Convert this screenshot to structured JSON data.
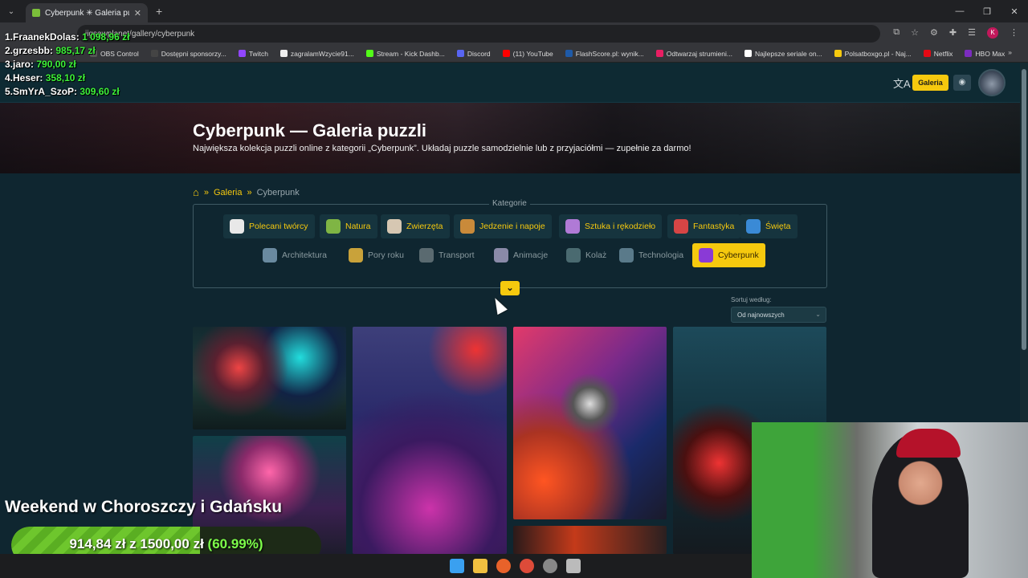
{
  "browser": {
    "tab_title": "Cyberpunk ✳ Galeria puzzli",
    "url": "jigsawplanet/gallery/cyberpunk",
    "bookmarks": [
      "OBS Control",
      "Dostępni sponsorzy...",
      "Twitch",
      "zagralamWzycie91...",
      "Stream - Kick Dashb...",
      "Discord",
      "(11) YouTube",
      "FlashScore.pl: wynik...",
      "Odtwarzaj strumieni...",
      "Najlepsze seriale on...",
      "Polsatboxgo.pl - Naj...",
      "Netflix",
      "HBO Max"
    ],
    "bookmark_colors": [
      "#555",
      "#444",
      "#9146ff",
      "#eee",
      "#53fc18",
      "#5865f2",
      "#ff0000",
      "#1e5aa8",
      "#e91e63",
      "#fff",
      "#f6c90e",
      "#e50914",
      "#7b2cbf"
    ]
  },
  "site": {
    "header_button": "Galeria",
    "hero_title": "Cyberpunk — Galeria puzzli",
    "hero_subtitle": "Największa kolekcja puzzli online z kategorii „Cyberpunk”. Układaj puzzle samodzielnie lub z przyjaciółmi — zupełnie za darmo!",
    "breadcrumb": {
      "root": "Galeria",
      "current": "Cyberpunk",
      "separator": "»"
    },
    "categories_title": "Kategorie",
    "categories_row1": [
      {
        "label": "Polecani twórcy",
        "color": "#e8e8e8"
      },
      {
        "label": "Natura",
        "color": "#7fb544"
      },
      {
        "label": "Zwierzęta",
        "color": "#d6c7b2"
      },
      {
        "label": "Jedzenie i napoje",
        "color": "#c98a3a"
      },
      {
        "label": "Sztuka i rękodzieło",
        "color": "#b07ad6"
      },
      {
        "label": "Fantastyka",
        "color": "#d64545"
      },
      {
        "label": "Święta",
        "color": "#3a8ad6"
      }
    ],
    "categories_row2": [
      {
        "label": "Architektura",
        "color": "#6a8aa0"
      },
      {
        "label": "Pory roku",
        "color": "#c9a23a"
      },
      {
        "label": "Transport",
        "color": "#5a6a70"
      },
      {
        "label": "Animacje",
        "color": "#8a8aa8"
      },
      {
        "label": "Kolaż",
        "color": "#4a6a70"
      },
      {
        "label": "Technologia",
        "color": "#5a7a8a"
      },
      {
        "label": "Cyberpunk",
        "color": "#8a3ad6"
      }
    ],
    "sort_label": "Sortuj według:",
    "sort_value": "Od najnowszych"
  },
  "overlay": {
    "leaderboard": [
      {
        "name": "1.FraanekDolas:",
        "value": "1 098,96 zł"
      },
      {
        "name": "2.grzesbb:",
        "value": "985,17 zł"
      },
      {
        "name": "3.jaro:",
        "value": "790,00 zł"
      },
      {
        "name": "4.Heser:",
        "value": "358,10 zł"
      },
      {
        "name": "5.SmYrA_SzoP:",
        "value": "309,60 zł"
      }
    ],
    "goal_title": "Weekend w Choroszczy i Gdańsku",
    "goal_current": "914,84 zł",
    "goal_of": "z",
    "goal_target": "1500,00 zł",
    "goal_percent": "(60.99%)",
    "goal_fraction": 0.6099
  }
}
